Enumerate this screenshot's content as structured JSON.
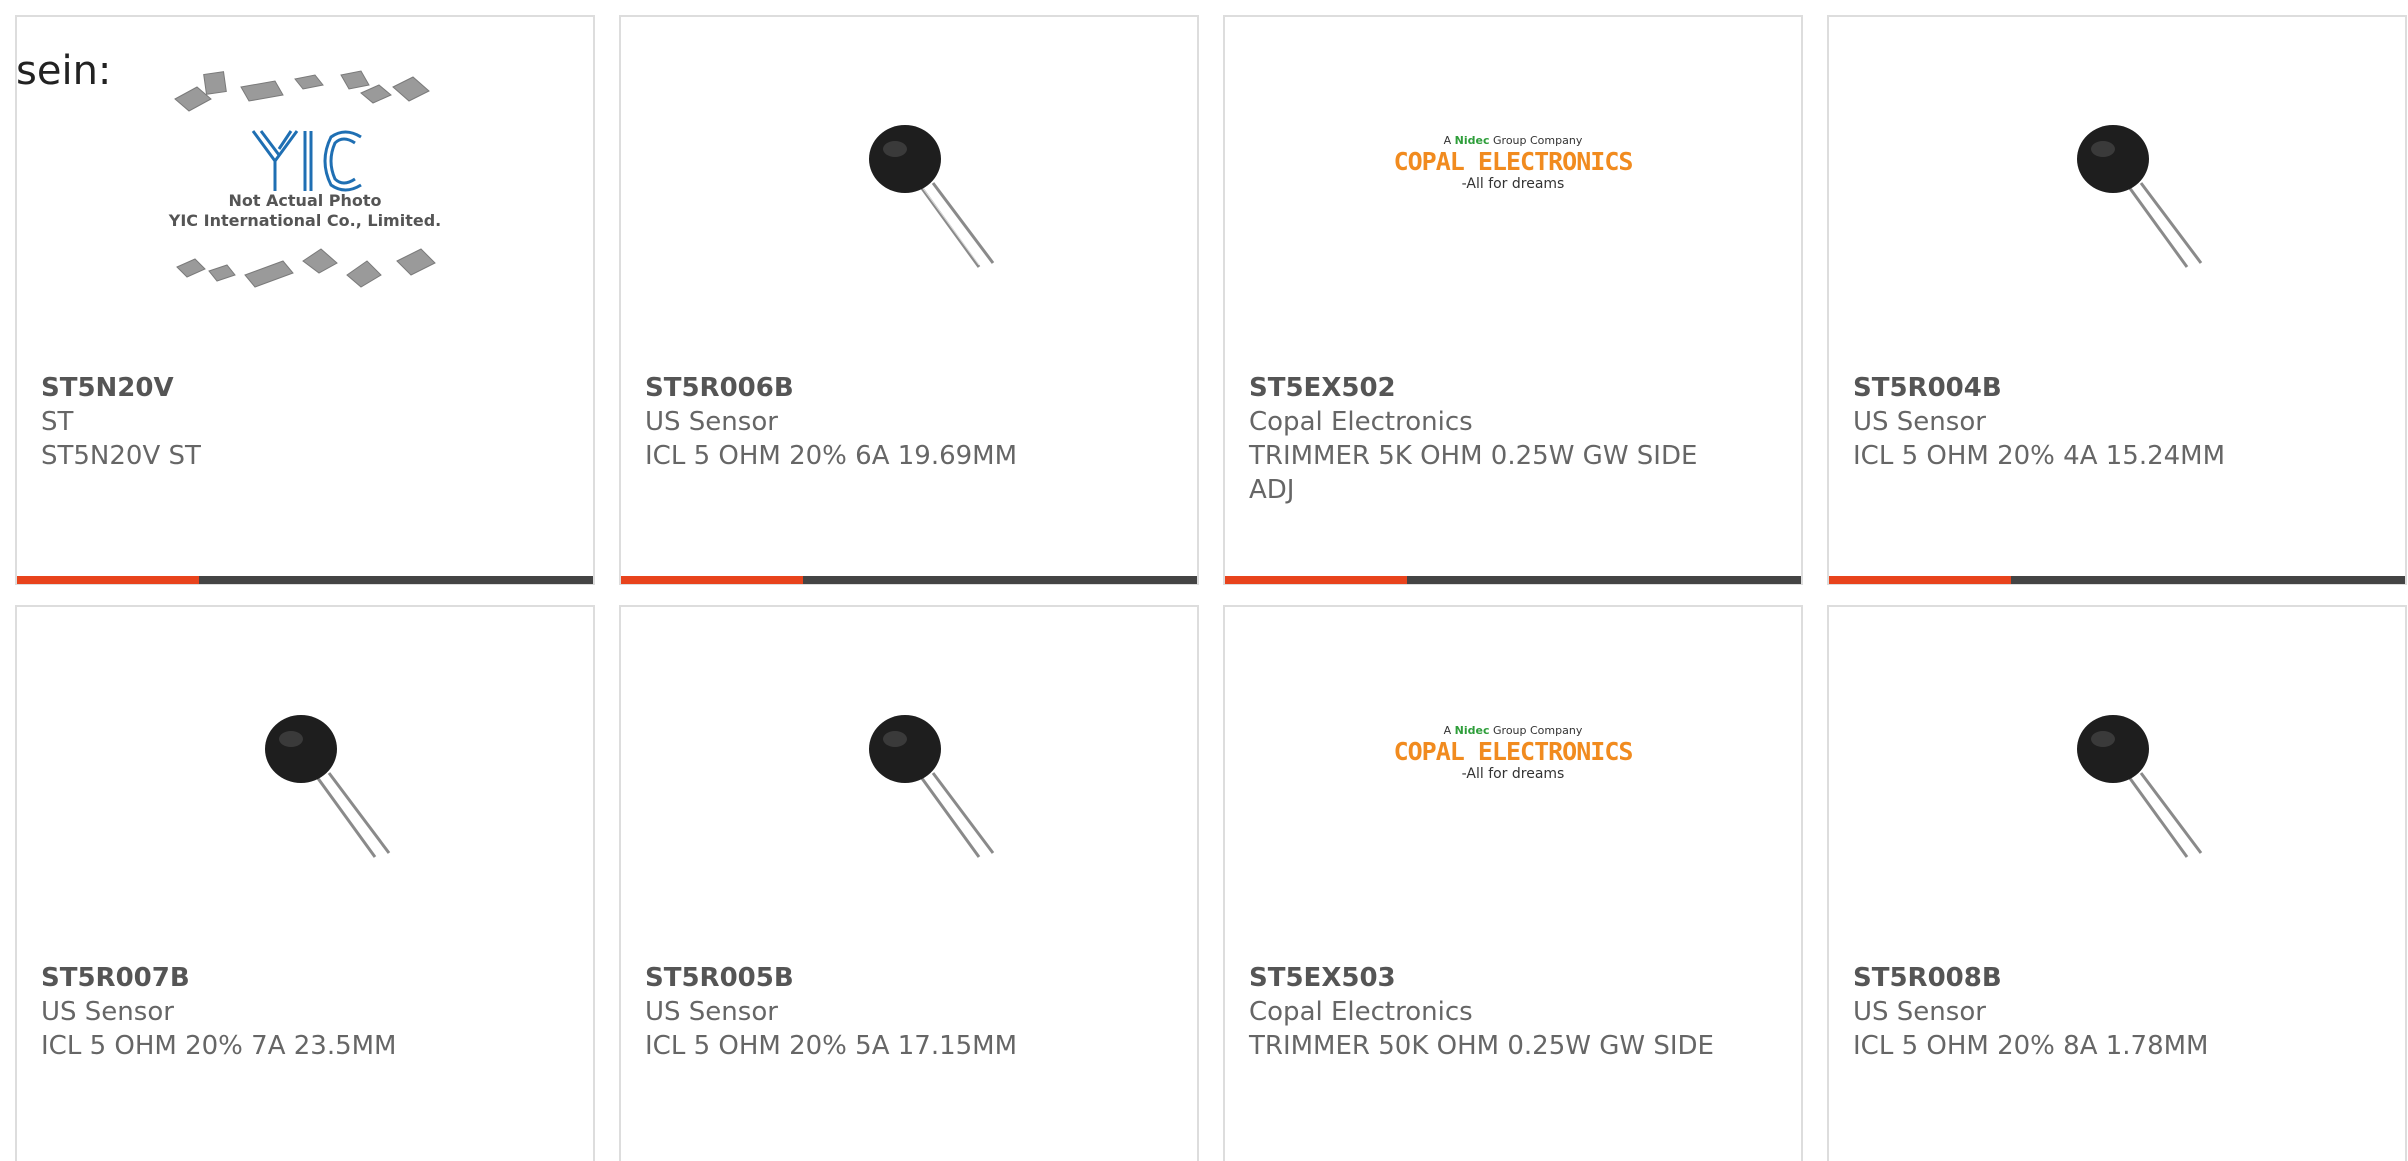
{
  "heading": {
    "text": "sein:"
  },
  "colors": {
    "accent": "#e8431c",
    "bar": "#444444",
    "border": "#dddddd"
  },
  "products": [
    {
      "part_number": "ST5N20V",
      "manufacturer": "ST",
      "description": "ST5N20V ST",
      "image": "yic-placeholder-image",
      "placeholder": {
        "line1": "Not Actual Photo",
        "line2": "YIC International Co., Limited."
      }
    },
    {
      "part_number": "ST5R006B",
      "manufacturer": "US Sensor",
      "description": "ICL 5 OHM 20% 6A 19.69MM",
      "image": "thermistor-image"
    },
    {
      "part_number": "ST5EX502",
      "manufacturer": "Copal Electronics",
      "description": "TRIMMER 5K OHM 0.25W GW SIDE ADJ",
      "image": "copal-logo",
      "logo": {
        "tagline_prefix": "A",
        "brand": "Nidec",
        "tagline_suffix": "Group Company",
        "name": "COPAL ELECTRONICS",
        "slogan": "-All for dreams"
      }
    },
    {
      "part_number": "ST5R004B",
      "manufacturer": "US Sensor",
      "description": "ICL 5 OHM 20% 4A 15.24MM",
      "image": "thermistor-image"
    },
    {
      "part_number": "ST5R007B",
      "manufacturer": "US Sensor",
      "description": "ICL 5 OHM 20% 7A 23.5MM",
      "image": "thermistor-image"
    },
    {
      "part_number": "ST5R005B",
      "manufacturer": "US Sensor",
      "description": "ICL 5 OHM 20% 5A 17.15MM",
      "image": "thermistor-image"
    },
    {
      "part_number": "ST5EX503",
      "manufacturer": "Copal Electronics",
      "description": "TRIMMER 50K OHM 0.25W GW SIDE",
      "image": "copal-logo",
      "logo": {
        "tagline_prefix": "A",
        "brand": "Nidec",
        "tagline_suffix": "Group Company",
        "name": "COPAL ELECTRONICS",
        "slogan": "-All for dreams"
      }
    },
    {
      "part_number": "ST5R008B",
      "manufacturer": "US Sensor",
      "description": "ICL 5 OHM 20% 8A 1.78MM",
      "image": "thermistor-image"
    }
  ]
}
